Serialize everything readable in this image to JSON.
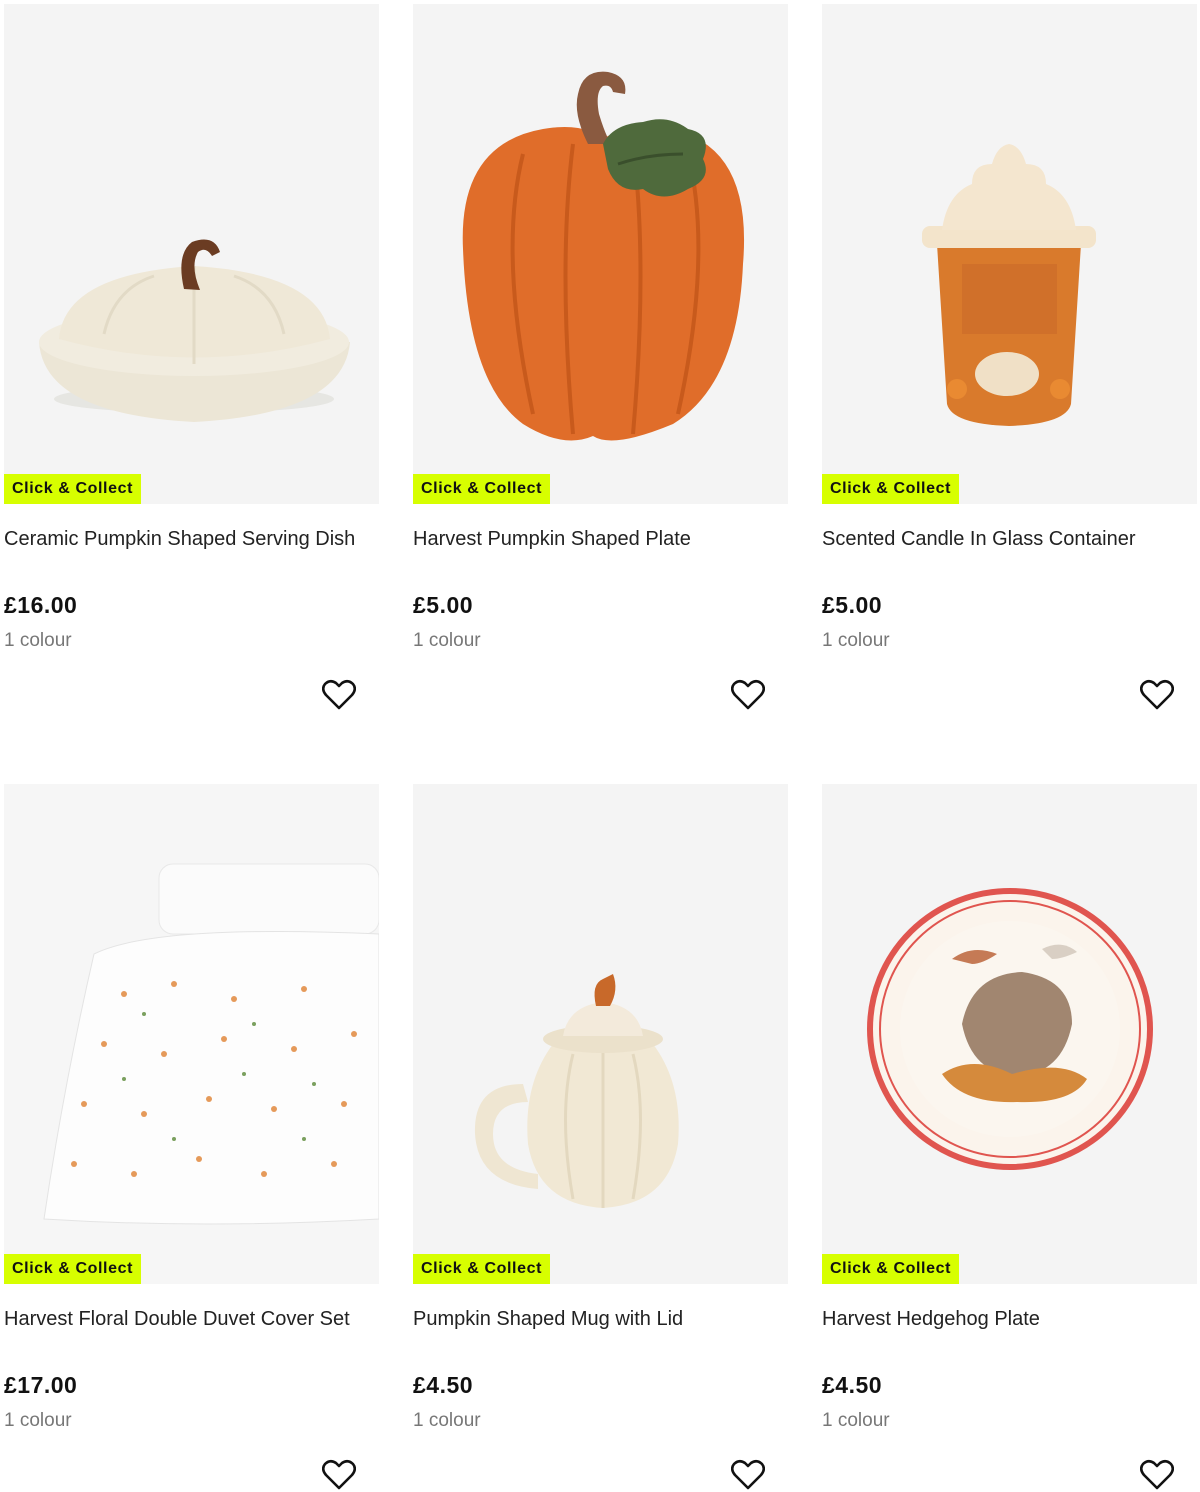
{
  "products": [
    {
      "badge": "Click & Collect",
      "title": "Ceramic Pumpkin Shaped Serving Dish",
      "price": "£16.00",
      "colours": "1 colour",
      "icon": "heart-outline-icon"
    },
    {
      "badge": "Click & Collect",
      "title": "Harvest Pumpkin Shaped Plate",
      "price": "£5.00",
      "colours": "1 colour",
      "icon": "heart-outline-icon"
    },
    {
      "badge": "Click & Collect",
      "title": "Scented Candle In Glass Container",
      "price": "£5.00",
      "colours": "1 colour",
      "icon": "heart-outline-icon"
    },
    {
      "badge": "Click & Collect",
      "title": "Harvest Floral Double Duvet Cover Set",
      "price": "£17.00",
      "colours": "1 colour",
      "icon": "heart-outline-icon"
    },
    {
      "badge": "Click & Collect",
      "title": "Pumpkin Shaped Mug with Lid",
      "price": "£4.50",
      "colours": "1 colour",
      "icon": "heart-outline-icon"
    },
    {
      "badge": "Click & Collect",
      "title": "Harvest Hedgehog Plate",
      "price": "£4.50",
      "colours": "1 colour",
      "icon": "heart-outline-icon"
    }
  ],
  "colors": {
    "badge": "#d7ff00",
    "image_bg": "#f4f4f4",
    "text": "#222222",
    "muted": "#777777"
  }
}
